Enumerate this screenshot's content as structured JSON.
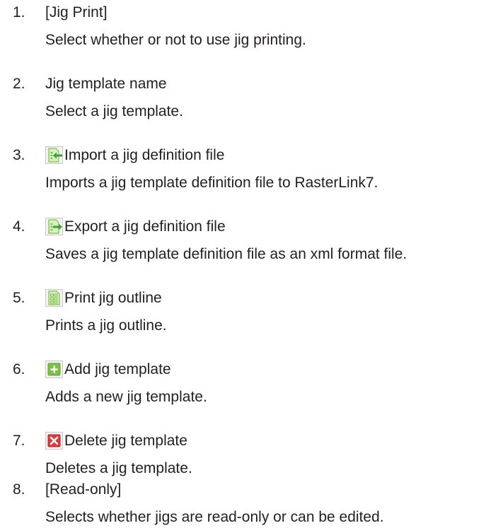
{
  "items": [
    {
      "num": "1.",
      "title": "[Jig Print]",
      "desc": "Select whether or not to use jig printing.",
      "icon": ""
    },
    {
      "num": "2.",
      "title": "Jig template name",
      "desc": "Select a jig template.",
      "icon": ""
    },
    {
      "num": "3.",
      "title": "Import a jig definition file",
      "desc": "Imports a jig template definition file to RasterLink7.",
      "icon": "import-file-icon"
    },
    {
      "num": "4.",
      "title": "Export a jig definition file",
      "desc": "Saves a jig template definition file as an xml format file.",
      "icon": "export-file-icon"
    },
    {
      "num": "5.",
      "title": "Print jig outline",
      "desc": "Prints a jig outline.",
      "icon": "print-outline-icon"
    },
    {
      "num": "6.",
      "title": "Add jig template",
      "desc": "Adds a new jig template.",
      "icon": "add-icon"
    },
    {
      "num": "7.",
      "title": "Delete jig template",
      "desc": "Deletes a jig template.",
      "icon": "delete-icon"
    },
    {
      "num": "8.",
      "title": "[Read-only]",
      "desc": "Selects whether jigs are read-only or can be edited.",
      "icon": ""
    }
  ],
  "colors": {
    "text": "#231f20",
    "icon_green": "#7cc242",
    "icon_light_green": "#d9efc4",
    "icon_red": "#e2363b"
  }
}
